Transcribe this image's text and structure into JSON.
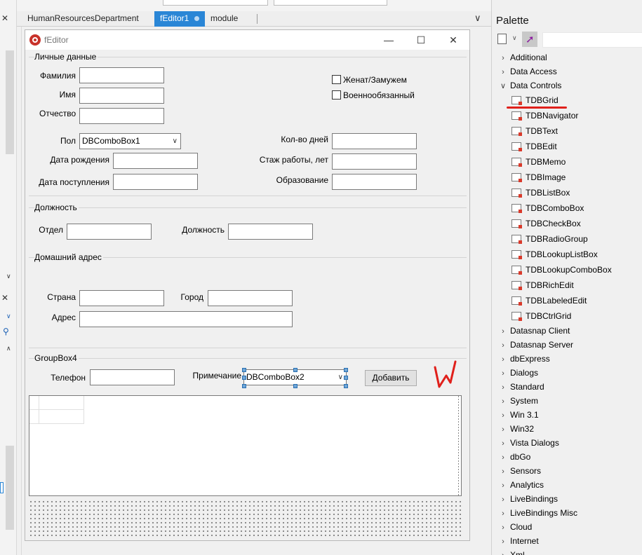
{
  "tabs": [
    {
      "label": "HumanResourcesDepartment",
      "active": false
    },
    {
      "label": "fEditor1",
      "active": true
    },
    {
      "label": "module",
      "active": false
    }
  ],
  "window": {
    "title": "fEditor",
    "minimize": "—",
    "maximize": "☐",
    "close": "✕"
  },
  "personal": {
    "caption": "Личные данные",
    "surname_label": "Фамилия",
    "name_label": "Имя",
    "patronymic_label": "Отчество",
    "married_label": "Женат/Замужем",
    "military_label": "Военнообязанный",
    "gender_label": "Пол",
    "gender_combo": "DBComboBox1",
    "birth_label": "Дата рождения",
    "hire_label": "Дата поступления",
    "days_label": "Кол-во дней",
    "experience_label": "Стаж работы, лет",
    "education_label": "Образование"
  },
  "position": {
    "caption": "Должность",
    "department_label": "Отдел",
    "position_label": "Должность"
  },
  "address": {
    "caption": "Домашний адрес",
    "country_label": "Страна",
    "city_label": "Город",
    "address_label": "Адрес"
  },
  "group4": {
    "caption": "GroupBox4",
    "phone_label": "Телефон",
    "note_label": "Примечание",
    "note_combo": "DBComboBox2",
    "add_button": "Добавить"
  },
  "palette": {
    "title": "Palette",
    "categories_top": [
      "Additional",
      "Data Access",
      "Data Controls"
    ],
    "data_controls": [
      "TDBGrid",
      "TDBNavigator",
      "TDBText",
      "TDBEdit",
      "TDBMemo",
      "TDBImage",
      "TDBListBox",
      "TDBComboBox",
      "TDBCheckBox",
      "TDBRadioGroup",
      "TDBLookupListBox",
      "TDBLookupComboBox",
      "TDBRichEdit",
      "TDBLabeledEdit",
      "TDBCtrlGrid"
    ],
    "categories_bottom": [
      "Datasnap Client",
      "Datasnap Server",
      "dbExpress",
      "Dialogs",
      "Standard",
      "System",
      "Win 3.1",
      "Win32",
      "Vista Dialogs",
      "dbGo",
      "Sensors",
      "Analytics",
      "LiveBindings",
      "LiveBindings Misc",
      "Cloud",
      "Internet",
      "Xml"
    ]
  },
  "colors": {
    "accent": "#2a86d6",
    "annotation": "#e0201b"
  }
}
